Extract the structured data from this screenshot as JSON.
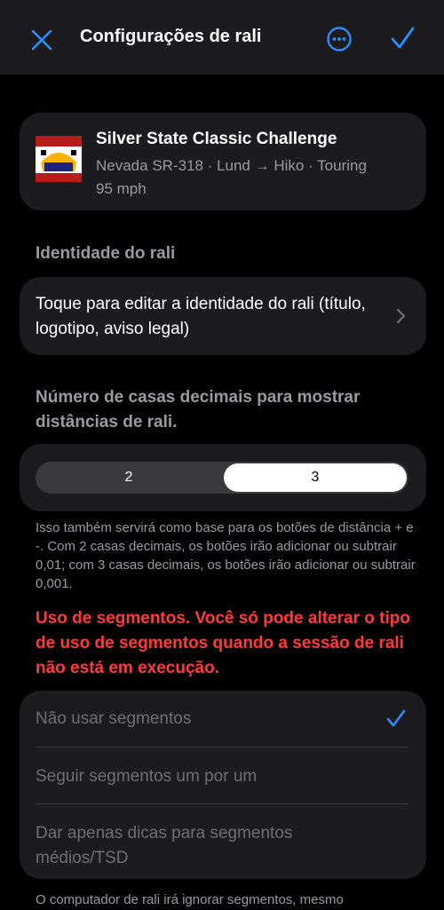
{
  "nav": {
    "title": "Configurações de rali",
    "close_icon": "close-icon",
    "more_icon": "more-icon",
    "confirm_icon": "checkmark-icon",
    "accent": "#2f8cff"
  },
  "rally": {
    "logo_text_top": "SILVER STATE CLASSIC",
    "logo_text_bottom": "CHALLENGE",
    "title": "Silver State Classic Challenge",
    "route": "Nevada SR-318 · Lund → Hiko · Touring",
    "speed": "95 mph"
  },
  "identity": {
    "label": "Identidade do rali",
    "edit_text": "Toque para editar a identidade do rali (título, logotipo, aviso legal)"
  },
  "decimals": {
    "label": "Número de casas decimais para mostrar distâncias de rali.",
    "options": [
      "2",
      "3"
    ],
    "selected": "3",
    "note": "Isso também servirá como base para os botões de distância + e -. Com 2 casas decimais, os botões irão adicionar ou subtrair 0,01; com 3 casas decimais, os botões irão adicionar ou subtrair 0,001."
  },
  "segments": {
    "warning": "Uso de segmentos. Você só pode alterar o tipo de uso de segmentos quando a sessão de rali não está em execução.",
    "options": [
      "Não usar segmentos",
      "Seguir segmentos um por um",
      "Dar apenas dicas para segmentos médios/TSD"
    ],
    "selected_index": 0,
    "footer": "O computador de rali irá ignorar segmentos, mesmo"
  }
}
